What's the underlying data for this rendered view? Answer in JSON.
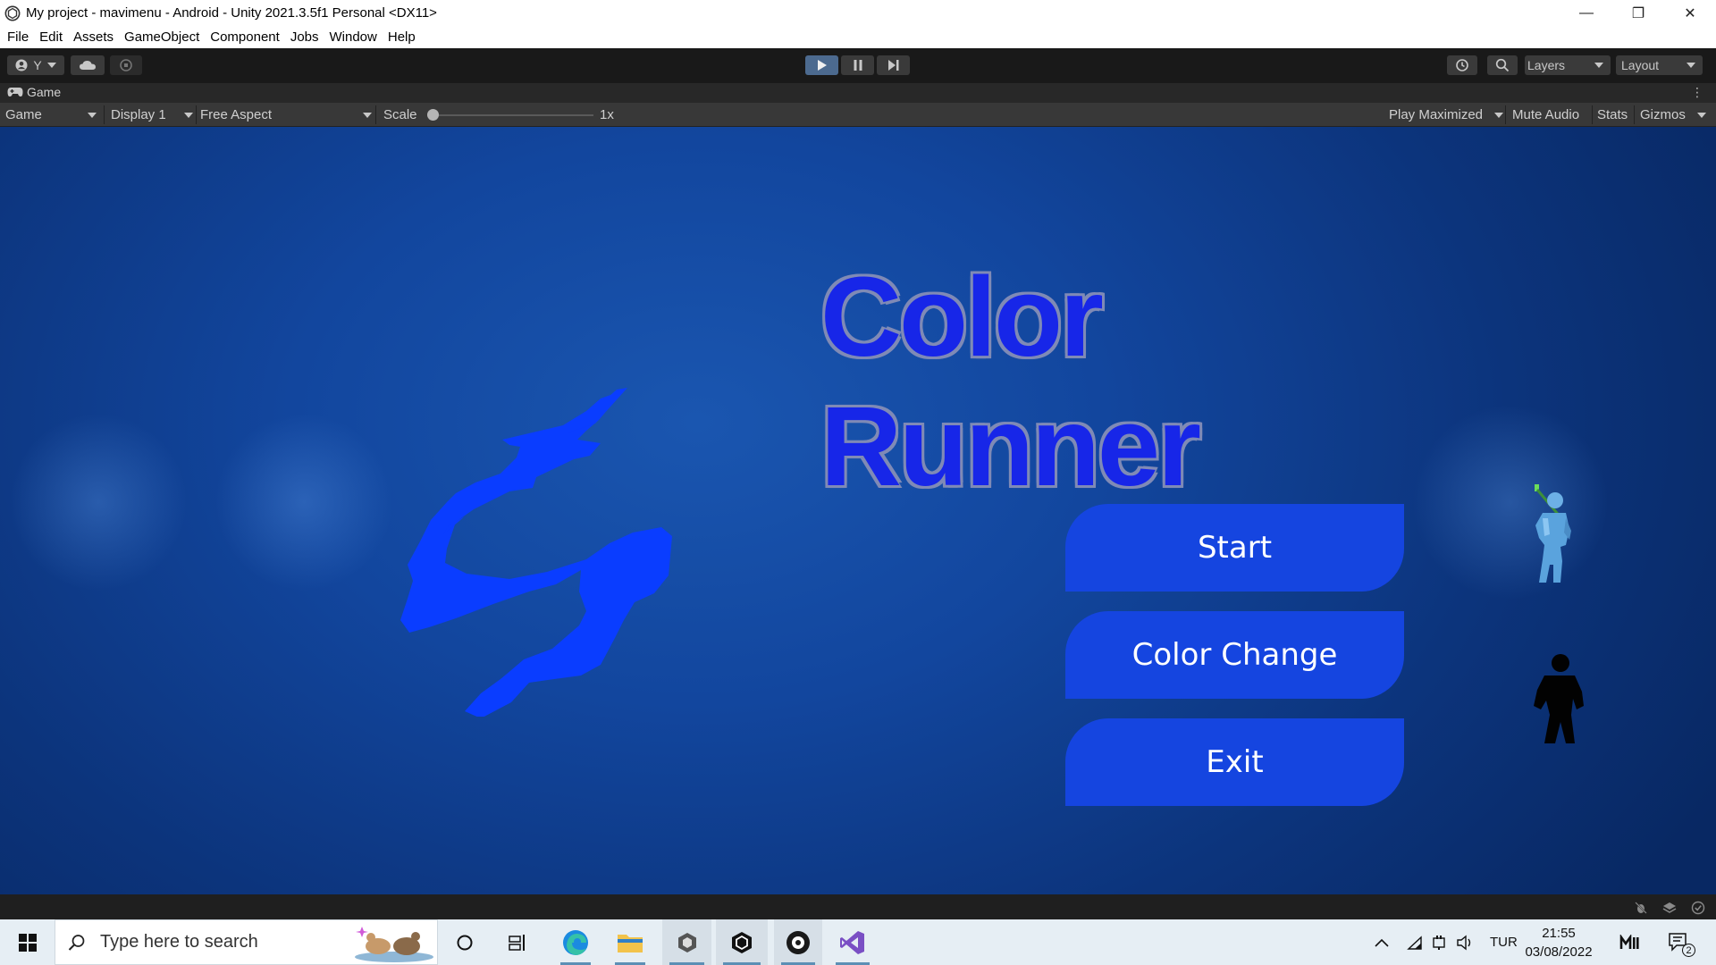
{
  "window": {
    "title": "My project - mavimenu - Android - Unity 2021.3.5f1 Personal <DX11>",
    "minimize": "—",
    "restore": "❐",
    "close": "✕"
  },
  "menu": [
    "File",
    "Edit",
    "Assets",
    "GameObject",
    "Component",
    "Jobs",
    "Window",
    "Help"
  ],
  "toolbar": {
    "account_label": "Y",
    "layers_label": "Layers",
    "layout_label": "Layout"
  },
  "game_tab": {
    "label": "Game",
    "kebab": "⋮"
  },
  "game_bar": {
    "view_select": "Game",
    "display_select": "Display 1",
    "aspect_select": "Free Aspect",
    "scale_label": "Scale",
    "scale_value": "1x",
    "scale_slider_fraction": 0.0,
    "play_maximized": "Play Maximized",
    "mute_audio": "Mute Audio",
    "stats": "Stats",
    "gizmos": "Gizmos"
  },
  "game": {
    "title": "Color Runner",
    "buttons": {
      "start": "Start",
      "color_change": "Color Change",
      "exit": "Exit"
    },
    "colors": {
      "button": "#1545e0",
      "title": "#1726e8",
      "brush": "#0a3dff"
    }
  },
  "taskbar": {
    "search_placeholder": "Type here to search",
    "language": "TUR",
    "time": "21:55",
    "date": "03/08/2022",
    "notification_count": "2"
  }
}
